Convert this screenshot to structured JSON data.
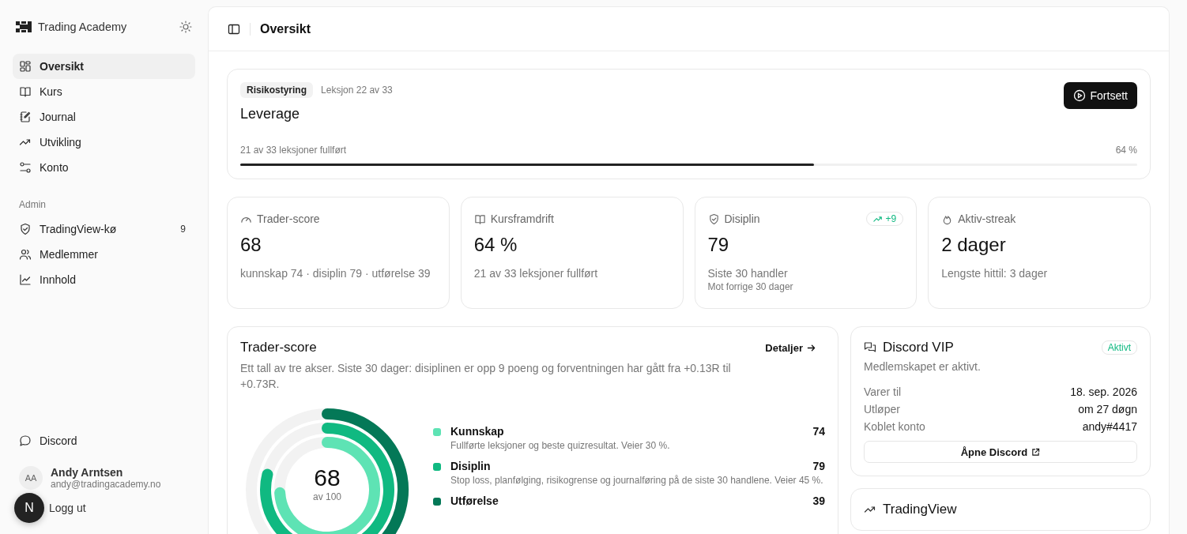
{
  "sidebar": {
    "brand": "Trading Academy",
    "nav": [
      {
        "label": "Oversikt",
        "selected": true
      },
      {
        "label": "Kurs",
        "selected": false
      },
      {
        "label": "Journal",
        "selected": false
      },
      {
        "label": "Utvikling",
        "selected": false
      },
      {
        "label": "Konto",
        "selected": false
      }
    ],
    "admin_heading": "Admin",
    "admin_nav": [
      {
        "label": "TradingView-kø",
        "count": "9",
        "selected": false
      },
      {
        "label": "Medlemmer",
        "selected": false
      },
      {
        "label": "Innhold",
        "selected": false
      }
    ],
    "discord_link": "Discord",
    "user": {
      "initials": "AA",
      "name": "Andy Arntsen",
      "email": "andy@tradingacademy.no"
    },
    "logout": "Logg ut",
    "dev_badge": "N"
  },
  "header": {
    "title": "Oversikt"
  },
  "lesson": {
    "tag": "Risikostyring",
    "position": "Leksjon 22 av 33",
    "title": "Leverage",
    "button": "Fortsett",
    "progress_text": "21 av 33 leksjoner fullført",
    "percent": "64 %",
    "level": 0.64
  },
  "stats": [
    {
      "label": "Trader-score",
      "value": "68",
      "detail": "kunnskap 74 · disiplin 79 · utførelse 39"
    },
    {
      "label": "Kursframdrift",
      "value": "64 %",
      "detail": "21 av 33 leksjoner fullført"
    },
    {
      "label": "Disiplin",
      "value": "79",
      "detail": "Siste 30 handler",
      "note": "Mot forrige 30 dager",
      "trend": "+9"
    },
    {
      "label": "Aktiv-streak",
      "value": "2 dager",
      "detail": "Lengste hittil: 3 dager"
    }
  ],
  "score_card": {
    "title": "Trader-score",
    "link": "Detaljer",
    "description": "Ett tall av tre akser. Siste 30 dager: disiplinen er opp 9 poeng og forventningen har gått fra +0.13R til +0.73R.",
    "total": "68",
    "total_caption": "av 100",
    "axes": [
      {
        "name": "Kunnskap",
        "description": "Fullførte leksjoner og beste quizresultat. Veier 30 %.",
        "score": "74",
        "color": "#5ee3b4"
      },
      {
        "name": "Disiplin",
        "description": "Stop loss, planfølging, risikogrense og journalføring på de siste 30 handlene. Veier 45 %.",
        "score": "79",
        "color": "#10b981"
      },
      {
        "name": "Utførelse",
        "score": "39",
        "color": "#047857"
      }
    ]
  },
  "discord_card": {
    "title": "Discord VIP",
    "status": "Aktivt",
    "subtitle": "Medlemskapet er aktivt.",
    "rows": [
      {
        "label": "Varer til",
        "value": "18. sep. 2026"
      },
      {
        "label": "Utløper",
        "value": "om 27 døgn"
      },
      {
        "label": "Koblet konto",
        "value": "andy#4417"
      }
    ],
    "button": "Åpne Discord"
  },
  "tradingview_card": {
    "title": "TradingView"
  }
}
